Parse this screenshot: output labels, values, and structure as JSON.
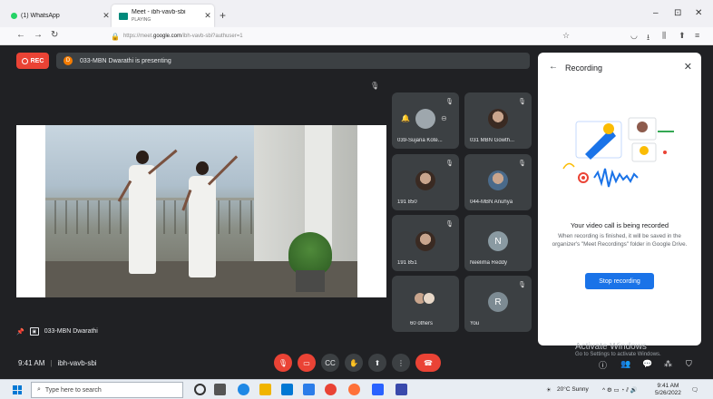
{
  "browser": {
    "tabs": [
      {
        "title": "(1) WhatsApp",
        "subtitle": ""
      },
      {
        "title": "Meet - ibh-vavb-sbi",
        "subtitle": "PLAYING"
      }
    ],
    "new_tab": "+",
    "window_controls": [
      "–",
      "⊡",
      "✕"
    ],
    "url_prefix": "https://meet.",
    "url_domain": "google.com",
    "url_path": "/ibh-vavb-sbi?authuser=1"
  },
  "meet": {
    "rec_label": "REC",
    "presenter_initial": "D",
    "presenting_text": "033-MBN Dwarathi is presenting",
    "pinned_name": "033-MBN Dwarathi",
    "participants": [
      {
        "name": "039-Sujana Kote...",
        "kind": "avatar"
      },
      {
        "name": "031 MBN Gowth...",
        "kind": "photo"
      },
      {
        "name": "191 850",
        "kind": "photo"
      },
      {
        "name": "044-MBN Anuhya",
        "kind": "photo"
      },
      {
        "name": "191 851",
        "kind": "photo"
      },
      {
        "name": "Neelima Reddy",
        "kind": "letter",
        "letter": "N"
      },
      {
        "name": "60 others",
        "kind": "group"
      },
      {
        "name": "You",
        "kind": "letter",
        "letter": "R"
      }
    ],
    "time": "9:41 AM",
    "meeting_code": "ibh-vavb-sbi"
  },
  "recording_panel": {
    "title": "Recording",
    "headline": "Your video call is being recorded",
    "description": "When recording is finished, it will be saved in the organizer's \"Meet Recordings\" folder in Google Drive.",
    "stop_button": "Stop recording"
  },
  "watermark": {
    "title": "Activate Windows",
    "subtitle": "Go to Settings to activate Windows."
  },
  "taskbar": {
    "search_placeholder": "Type here to search",
    "weather": "20°C  Sunny",
    "time": "9:41 AM",
    "date": "5/26/2022"
  },
  "colors": {
    "meet_bg": "#202124",
    "tile_bg": "#3c4043",
    "rec_red": "#ea4335",
    "accent_blue": "#1a73e8"
  }
}
